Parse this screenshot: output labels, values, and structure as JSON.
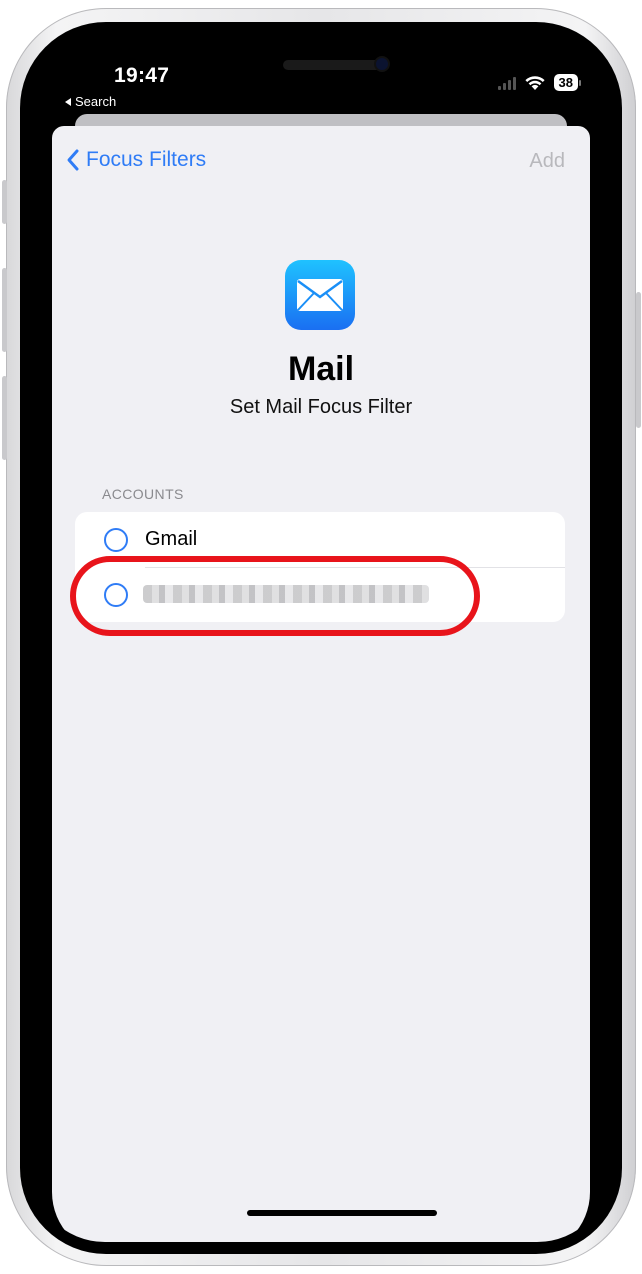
{
  "status_bar": {
    "time": "19:47",
    "back_app": "Search",
    "battery": "38"
  },
  "nav": {
    "back_label": "Focus Filters",
    "add_label": "Add"
  },
  "app": {
    "name": "Mail",
    "subtitle": "Set Mail Focus Filter",
    "icon": "mail-envelope-icon"
  },
  "accounts": {
    "header": "ACCOUNTS",
    "items": [
      {
        "label": "Gmail",
        "selected": false
      },
      {
        "label": "",
        "selected": false,
        "redacted": true
      }
    ]
  },
  "colors": {
    "accent": "#2f7cf6",
    "highlight": "#e8141b",
    "sheet_background": "#f0f0f4"
  }
}
